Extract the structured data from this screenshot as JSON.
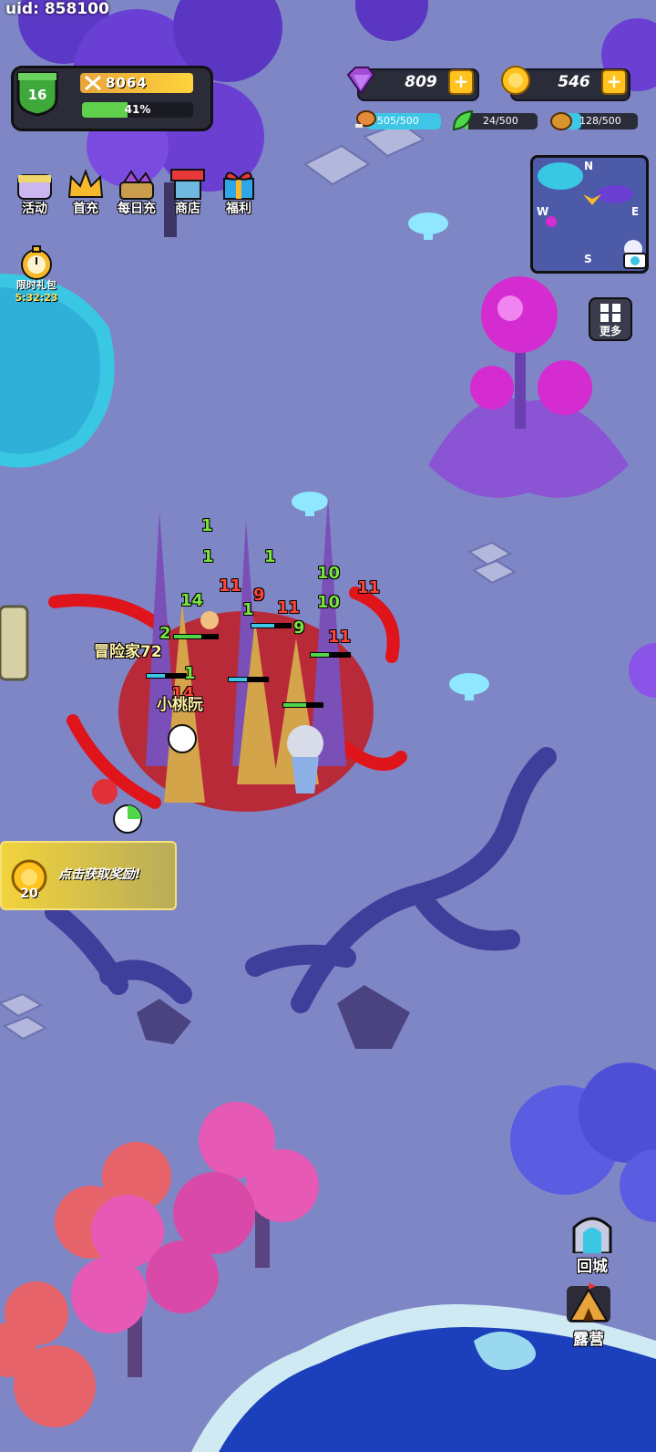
{
  "uid_text": "uid: 858100",
  "player": {
    "level": "16",
    "combat_power": "8064",
    "xp_percent_label": "41%",
    "xp_progress": 0.41
  },
  "currency": {
    "gems": "809",
    "gold": "546"
  },
  "resources": {
    "food": {
      "label": "505/500",
      "fill": 1.0,
      "color": "#3ec6e6"
    },
    "herb": {
      "label": "24/500",
      "fill": 0.05,
      "color": "#5fcf4c"
    },
    "nut": {
      "label": "128/500",
      "fill": 0.26,
      "color": "#3ec6e6"
    }
  },
  "menu": [
    {
      "label": "活动",
      "icon": "chest-icon"
    },
    {
      "label": "首充",
      "icon": "crown-icon"
    },
    {
      "label": "每日充",
      "icon": "gem-pile-icon"
    },
    {
      "label": "商店",
      "icon": "shop-icon"
    },
    {
      "label": "福利",
      "icon": "gift-icon"
    }
  ],
  "limited_pack": {
    "label": "限时礼包",
    "timer": "5:32:23"
  },
  "minimap": {
    "n": "N",
    "w": "W",
    "e": "E",
    "s": "S"
  },
  "more_label": "更多",
  "return_city_label": "回城",
  "camp_label": "露营",
  "reward_banner": {
    "amount": "20",
    "text": "点击获取奖励!"
  },
  "battle": {
    "heal_numbers": [
      "1",
      "1",
      "14",
      "2",
      "1",
      "1",
      "1",
      "10",
      "10",
      "9"
    ],
    "damage_numbers": [
      "11",
      "11",
      "11",
      "11",
      "14",
      "9"
    ],
    "name_tags": [
      "冒险家72",
      "小桃阮"
    ]
  },
  "colors": {
    "ground": "#7f86c6",
    "gold": "#ffc21e",
    "gem": "#a34dd6",
    "blood": "#e0141b"
  }
}
